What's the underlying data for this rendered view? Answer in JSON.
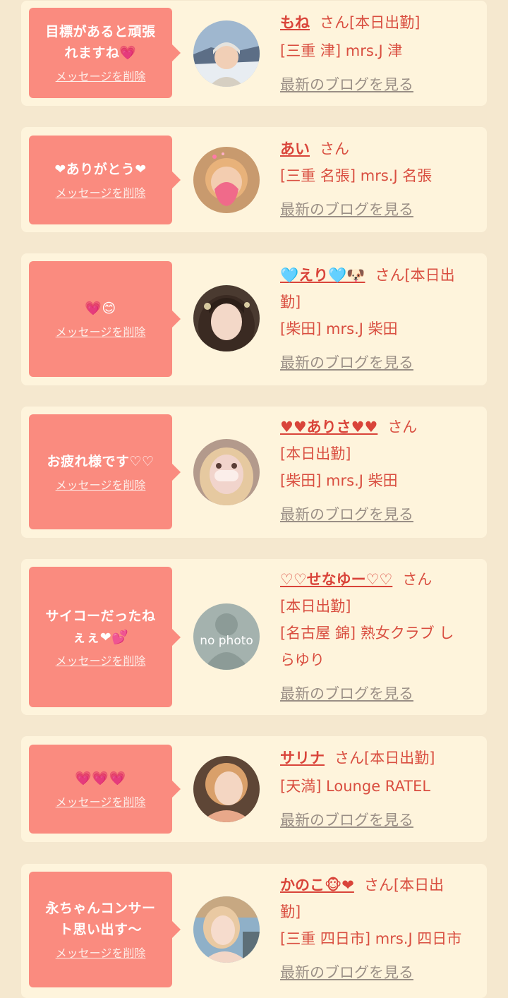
{
  "cards": [
    {
      "message": [
        "目標があると頑張",
        "れますね💗"
      ],
      "delete_label": "メッセージを削除",
      "name": "もね",
      "suffix": "さん[本日出勤]",
      "location": "[三重 津] mrs.J 津",
      "location2": "",
      "blog_label": "最新のブログを見る"
    },
    {
      "message": [
        "❤ありがとう❤"
      ],
      "delete_label": "メッセージを削除",
      "name": "あい",
      "suffix": "さん",
      "location": "[三重 名張] mrs.J 名張",
      "location2": "",
      "blog_label": "最新のブログを見る"
    },
    {
      "message": [
        "💗😊"
      ],
      "delete_label": "メッセージを削除",
      "name": "🩵えり🩵🐶",
      "suffix": "さん[本日出",
      "suffix2": "勤]",
      "location": "[柴田] mrs.J 柴田",
      "location2": "",
      "blog_label": "最新のブログを見る"
    },
    {
      "message": [
        "お疲れ様です♡♡"
      ],
      "delete_label": "メッセージを削除",
      "name": "♥♥ありさ♥♥",
      "suffix": "さん",
      "suffix2": "[本日出勤]",
      "location": "[柴田] mrs.J 柴田",
      "location2": "",
      "blog_label": "最新のブログを見る"
    },
    {
      "message": [
        "サイコーだったね",
        "ぇぇ❤💕"
      ],
      "delete_label": "メッセージを削除",
      "name": "♡♡せなゆー♡♡",
      "suffix": "さん",
      "suffix2": "[本日出勤]",
      "location": "[名古屋 錦] 熟女クラブ し",
      "location2": "らゆり",
      "avatar_text": "no photo",
      "blog_label": "最新のブログを見る"
    },
    {
      "message": [
        "💗💗💗"
      ],
      "delete_label": "メッセージを削除",
      "name": "サリナ",
      "suffix": "さん[本日出勤]",
      "location": "[天満] Lounge RATEL",
      "location2": "",
      "blog_label": "最新のブログを見る"
    },
    {
      "message": [
        "永ちゃんコンサー",
        "ト思い出す〜"
      ],
      "delete_label": "メッセージを削除",
      "name": "かのこ🐵❤",
      "suffix": "さん[本日出",
      "suffix2": "勤]",
      "location": "[三重 四日市] mrs.J 四日市",
      "location2": "",
      "blog_label": "最新のブログを見る"
    }
  ],
  "colors": {
    "background": "#f5e8cf",
    "card": "#fef4dc",
    "bubble": "#fa8b7f",
    "name": "#d9443a",
    "text": "#d94e40",
    "link_muted": "#9a8f86"
  }
}
